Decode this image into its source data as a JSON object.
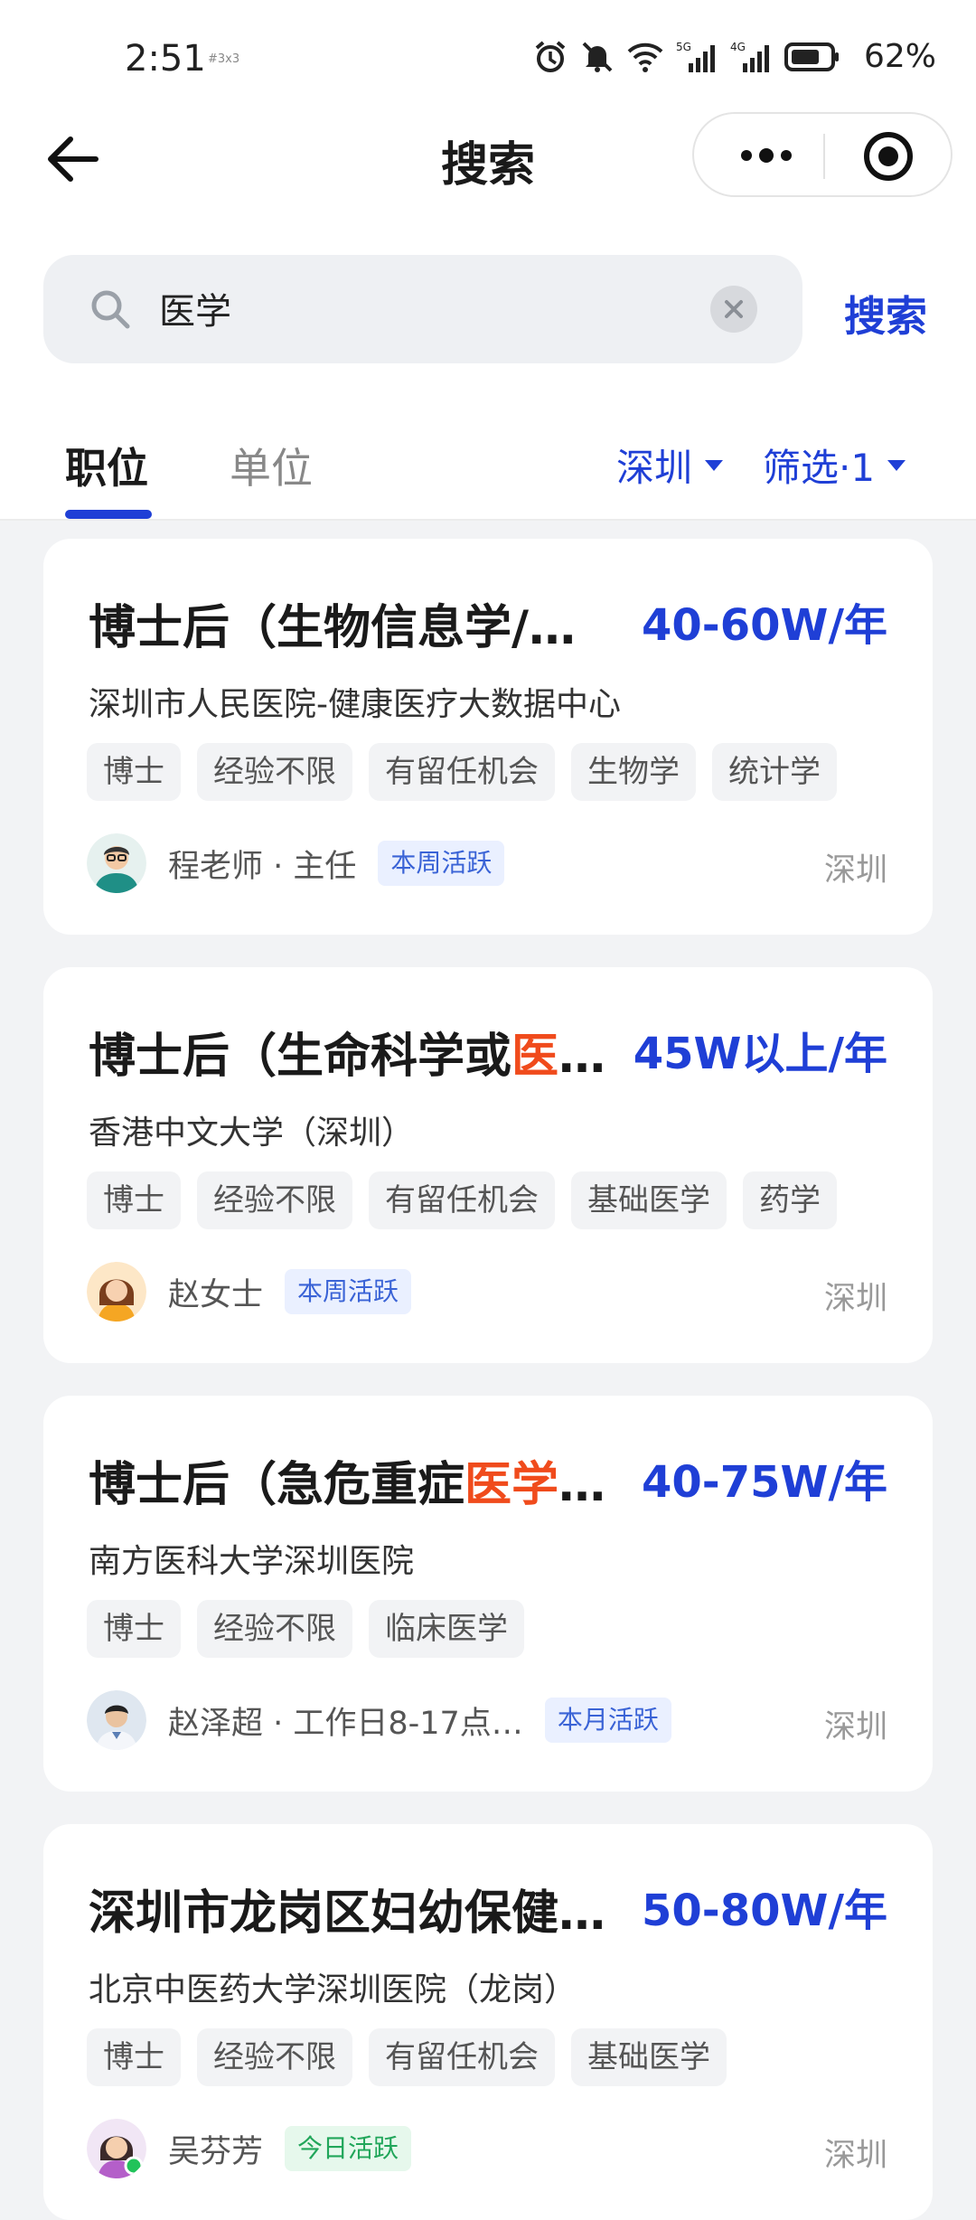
{
  "status_bar": {
    "time": "2:51",
    "small_tag": "#3x3",
    "signal_labels": [
      "5G",
      "4G"
    ],
    "battery": "62%"
  },
  "nav": {
    "title": "搜索"
  },
  "search": {
    "query": "医学",
    "submit_label": "搜索"
  },
  "tabs": [
    {
      "label": "职位",
      "active": true
    },
    {
      "label": "单位",
      "active": false
    }
  ],
  "filters": {
    "city": "深圳",
    "filter_label": "筛选·1"
  },
  "accent_color": "#1f3fd6",
  "highlight_color": "#f04b1c",
  "jobs": [
    {
      "title_pre": "博士后（生物信息学/…",
      "title_hl": "",
      "title_post": "",
      "salary": "40-60W/年",
      "company": "深圳市人民医院-健康医疗大数据中心",
      "tags": [
        "博士",
        "经验不限",
        "有留任机会",
        "生物学",
        "统计学"
      ],
      "recruiter": "程老师 · 主任",
      "activity": "本周活跃",
      "location": "深圳"
    },
    {
      "title_pre": "博士后（生命科学或",
      "title_hl": "医",
      "title_post": "…",
      "salary": "45W以上/年",
      "company": "香港中文大学（深圳）",
      "tags": [
        "博士",
        "经验不限",
        "有留任机会",
        "基础医学",
        "药学"
      ],
      "recruiter": "赵女士",
      "activity": "本周活跃",
      "location": "深圳"
    },
    {
      "title_pre": "博士后（急危重症",
      "title_hl": "医学",
      "title_post": "…",
      "salary": "40-75W/年",
      "company": "南方医科大学深圳医院",
      "tags": [
        "博士",
        "经验不限",
        "临床医学"
      ],
      "recruiter": "赵泽超 · 工作日8-17点…",
      "activity": "本月活跃",
      "location": "深圳"
    },
    {
      "title_pre": "深圳市龙岗区妇幼保健…",
      "title_hl": "",
      "title_post": "",
      "salary": "50-80W/年",
      "company": "北京中医药大学深圳医院（龙岗）",
      "tags": [
        "博士",
        "经验不限",
        "有留任机会",
        "基础医学"
      ],
      "recruiter": "吴芬芳",
      "activity": "今日活跃",
      "location": "深圳"
    }
  ]
}
